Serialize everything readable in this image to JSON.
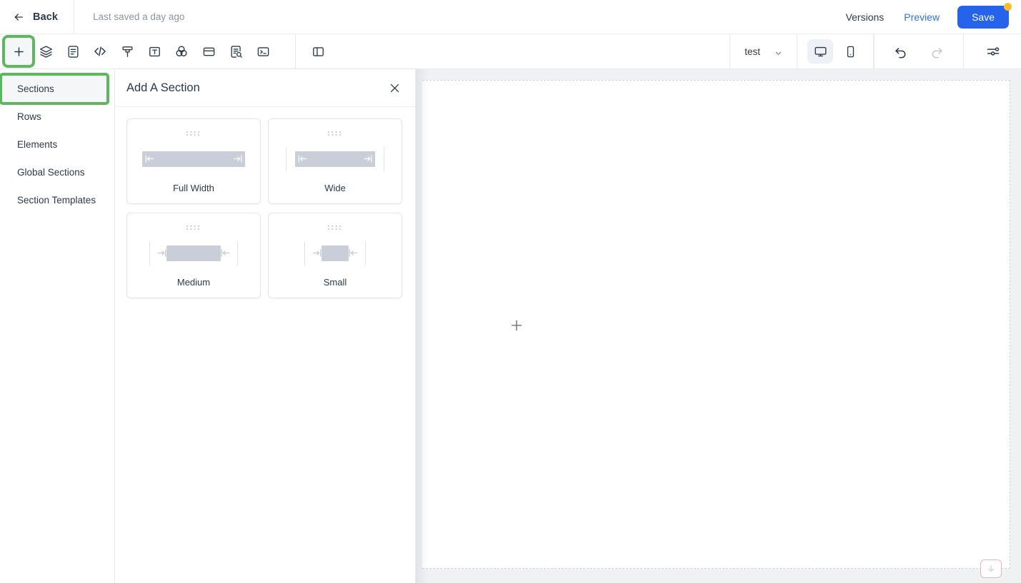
{
  "header": {
    "back_label": "Back",
    "saved_text": "Last saved a day ago",
    "versions_label": "Versions",
    "preview_label": "Preview",
    "save_label": "Save",
    "save_badge_color": "#fbbf24",
    "save_button_color": "#2563eb",
    "preview_link_color": "#2d6ef5"
  },
  "toolbar": {
    "highlight_color": "#5cb85c",
    "document_name": "test",
    "tools": [
      {
        "name": "add-icon",
        "label": "Add"
      },
      {
        "name": "layers-icon",
        "label": "Layers"
      },
      {
        "name": "page-content-icon",
        "label": "Content"
      },
      {
        "name": "code-icon",
        "label": "Code"
      },
      {
        "name": "brush-icon",
        "label": "Styles"
      },
      {
        "name": "text-box-icon",
        "label": "Text"
      },
      {
        "name": "color-blend-icon",
        "label": "Theme"
      },
      {
        "name": "card-layout-icon",
        "label": "Layout"
      },
      {
        "name": "page-search-icon",
        "label": "SEO"
      },
      {
        "name": "terminal-icon",
        "label": "Console"
      },
      {
        "name": "split-panel-icon",
        "label": "Split View"
      }
    ],
    "devices": [
      {
        "name": "desktop-view-icon",
        "label": "Desktop",
        "active": true
      },
      {
        "name": "mobile-view-icon",
        "label": "Mobile",
        "active": false
      }
    ],
    "actions": [
      {
        "name": "undo-icon",
        "label": "Undo",
        "enabled": true
      },
      {
        "name": "redo-icon",
        "label": "Redo",
        "enabled": false
      },
      {
        "name": "settings-sliders-icon",
        "label": "Settings",
        "enabled": true
      }
    ]
  },
  "sidebar": {
    "items": [
      {
        "label": "Sections",
        "active": true
      },
      {
        "label": "Rows",
        "active": false
      },
      {
        "label": "Elements",
        "active": false
      },
      {
        "label": "Global Sections",
        "active": false
      },
      {
        "label": "Section Templates",
        "active": false
      }
    ]
  },
  "panel": {
    "title": "Add A Section",
    "close_label": "Close",
    "cards": [
      {
        "label": "Full Width",
        "variant": "full"
      },
      {
        "label": "Wide",
        "variant": "wide"
      },
      {
        "label": "Medium",
        "variant": "medium"
      },
      {
        "label": "Small",
        "variant": "small"
      }
    ]
  },
  "canvas": {
    "add_section_label": "Add section",
    "bottom_handle_label": "Move down"
  }
}
